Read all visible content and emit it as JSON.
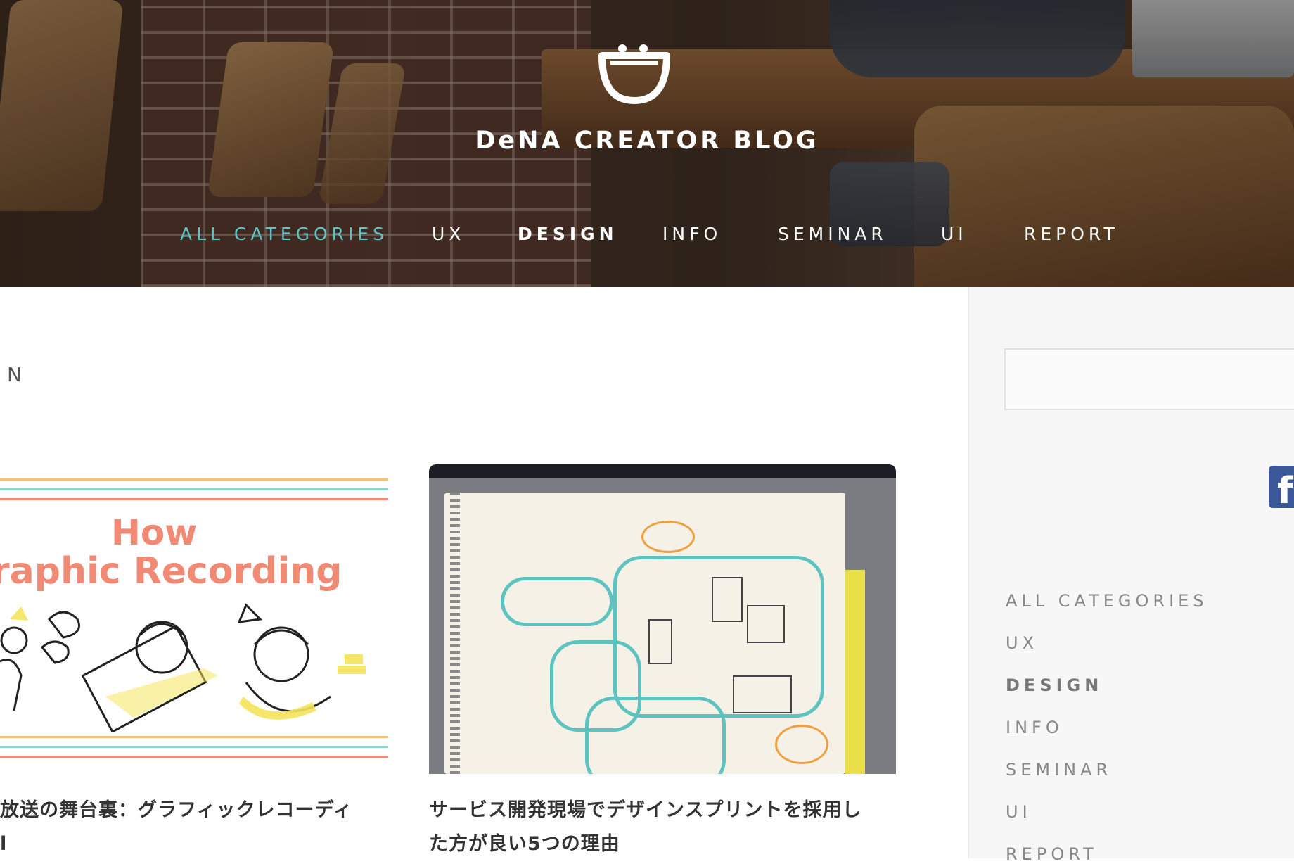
{
  "header": {
    "blog_title": "DeNA CREATOR BLOG",
    "nav": [
      {
        "label": "ALL CATEGORIES",
        "state": "active"
      },
      {
        "label": "UX"
      },
      {
        "label": "DESIGN",
        "state": "current"
      },
      {
        "label": "INFO"
      },
      {
        "label": "SEMINAR"
      },
      {
        "label": "UI"
      },
      {
        "label": "REPORT"
      }
    ]
  },
  "main": {
    "section_heading": "N",
    "cards": [
      {
        "image_text_line1": "How",
        "image_text_line2": "raphic Recording",
        "title_line1": "放送の舞台裏：グラフィックレコーディ",
        "title_line2": "l"
      },
      {
        "title_line1": "サービス開発現場でデザインスプリントを採用し",
        "title_line2": "た方が良い5つの理由"
      }
    ]
  },
  "sidebar": {
    "search": {
      "placeholder": ""
    },
    "facebook_icon": "f",
    "categories": [
      "ALL CATEGORIES",
      "UX",
      "DESIGN",
      "INFO",
      "SEMINAR",
      "UI",
      "REPORT"
    ]
  },
  "colors": {
    "accent_teal": "#5ec6c6",
    "coral": "#f08a74",
    "facebook_blue": "#3b5998"
  }
}
